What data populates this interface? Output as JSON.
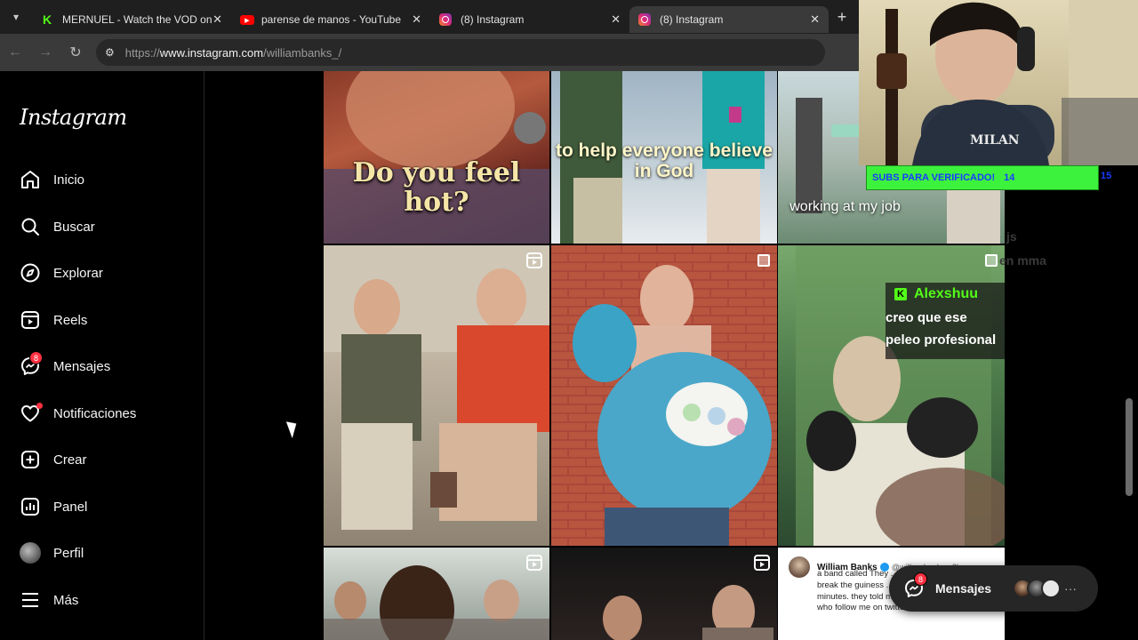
{
  "browser": {
    "tabs": [
      {
        "title": "MERNUEL - Watch the VOD on",
        "favicon": "kick-icon",
        "active": false
      },
      {
        "title": "parense de manos - YouTube",
        "favicon": "youtube-icon",
        "active": false
      },
      {
        "title": "(8) Instagram",
        "favicon": "instagram-icon",
        "active": false
      },
      {
        "title": "(8) Instagram",
        "favicon": "instagram-icon",
        "active": true
      }
    ],
    "address": {
      "prefix": "https://",
      "host": "www.instagram.com",
      "path": "/williambanks_/"
    }
  },
  "instagram": {
    "logo": "Instagram",
    "nav": [
      {
        "label": "Inicio",
        "icon": "home-icon"
      },
      {
        "label": "Buscar",
        "icon": "search-icon"
      },
      {
        "label": "Explorar",
        "icon": "compass-icon"
      },
      {
        "label": "Reels",
        "icon": "reels-icon"
      },
      {
        "label": "Mensajes",
        "icon": "messenger-icon",
        "badge": "8"
      },
      {
        "label": "Notificaciones",
        "icon": "heart-icon",
        "dot": true
      },
      {
        "label": "Crear",
        "icon": "plus-square-icon"
      },
      {
        "label": "Panel",
        "icon": "chart-icon"
      },
      {
        "label": "Perfil",
        "icon": "avatar"
      },
      {
        "label": "Más",
        "icon": "hamburger-icon"
      }
    ],
    "posts": {
      "r1c1_caption": "Do you feel hot?",
      "r1c2_caption": "to help everyone believe in God",
      "r1c3_caption": "working at my job"
    },
    "tweet": {
      "name": "William Banks",
      "handle": "@williambanks · 2h",
      "text": "a band called They ... Water has hired me ... break the guiness ... have the most amoun... minutes. they told me to invite all of the women who follow me on twitter to come to"
    },
    "messages_pill": {
      "label": "Mensajes",
      "badge": "8"
    }
  },
  "stream": {
    "subs_label": "SUBS PARA VERIFICADO!",
    "subs_count": "14",
    "subs_goal": "15",
    "chat": {
      "user": "Alexshuu",
      "message": "creo que ese peleo profesional"
    },
    "faded_1": "js",
    "faded_2": "en mma",
    "hoodie_text": "MILAN"
  },
  "colors": {
    "kick_green": "#53fc18",
    "ig_badge": "#ff3040",
    "subs_bar": "#3df23d"
  }
}
